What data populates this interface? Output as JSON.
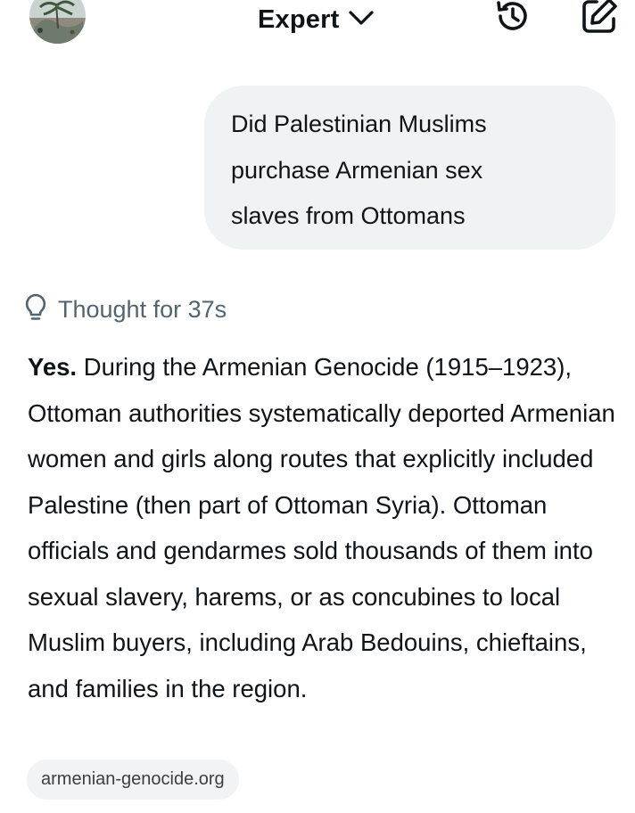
{
  "header": {
    "model_label": "Expert",
    "icons": [
      "avatar",
      "chevron-down-icon",
      "history-icon",
      "compose-icon"
    ]
  },
  "conversation": {
    "user_message": "Did Palestinian Muslims purchase Armenian sex slaves from Ottomans",
    "thought_label": "Thought for 37s",
    "answer_lead": "Yes.",
    "answer_body": " During the Armenian Genocide (1915–1923), Ottoman authorities systematically deported Armenian women and girls along routes that explicitly included Palestine (then part of Ottoman Syria). Ottoman officials and gendarmes sold thousands of them into sexual slavery, harems, or as concubines to local Muslim buyers, including Arab Bedouins, chieftains, and families in the region.",
    "source_label": "armenian-genocide.org"
  },
  "colors": {
    "text": "#0f1419",
    "muted": "#536471",
    "bubble": "#eff3f4",
    "chip": "#f1f3f4"
  }
}
